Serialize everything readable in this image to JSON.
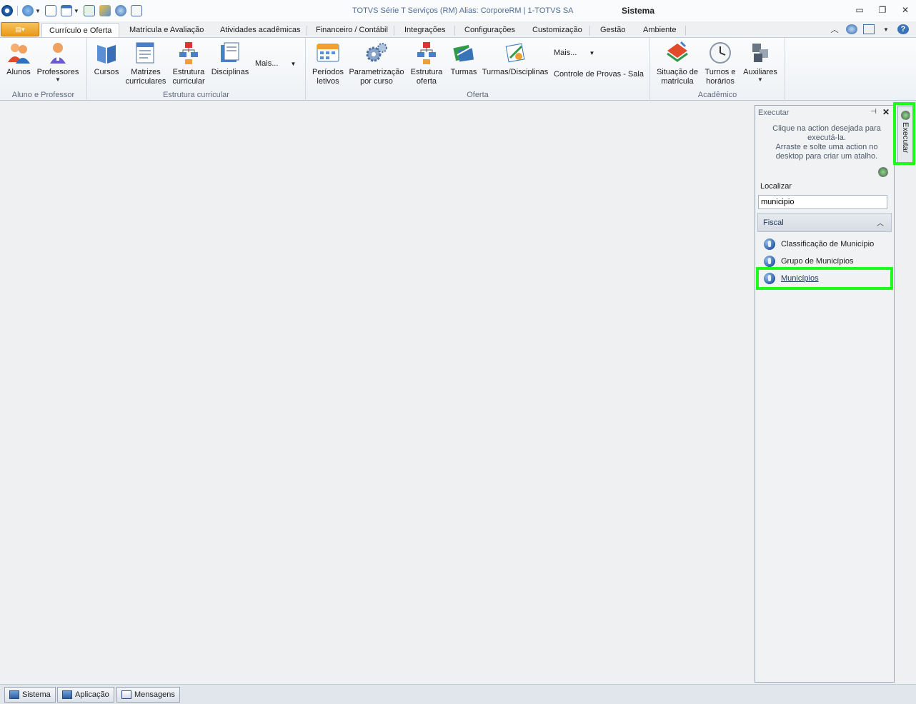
{
  "window": {
    "title": "TOTVS Série T Serviços (RM) Alias: CorporeRM | 1-TOTVS SA",
    "context": "Sistema"
  },
  "tabs": [
    {
      "label": "Currículo e Oferta"
    },
    {
      "label": "Matrícula e Avaliação"
    },
    {
      "label": "Atividades acadêmicas"
    },
    {
      "label": "Financeiro / Contábil"
    },
    {
      "label": "Integrações"
    },
    {
      "label": "Configurações"
    },
    {
      "label": "Customização"
    },
    {
      "label": "Gestão"
    },
    {
      "label": "Ambiente"
    }
  ],
  "ribbon": {
    "groups": {
      "aluno_professor": {
        "label": "Aluno e Professor",
        "buttons": {
          "alunos": "Alunos",
          "professores": "Professores"
        }
      },
      "estrutura": {
        "label": "Estrutura curricular",
        "buttons": {
          "cursos": "Cursos",
          "matrizes_1": "Matrizes",
          "matrizes_2": "curriculares",
          "estrutura_1": "Estrutura",
          "estrutura_2": "curricular",
          "disciplinas": "Disciplinas",
          "mais": "Mais..."
        }
      },
      "oferta": {
        "label": "Oferta",
        "buttons": {
          "periodos_1": "Períodos",
          "periodos_2": "letivos",
          "param_1": "Parametrização",
          "param_2": "por curso",
          "estrutura_oferta_1": "Estrutura",
          "estrutura_oferta_2": "oferta",
          "turmas": "Turmas",
          "turmas_disciplinas": "Turmas/Disciplinas",
          "mais": "Mais...",
          "controle_provas": "Controle de Provas - Sala"
        }
      },
      "academico": {
        "label": "Acadêmico",
        "buttons": {
          "situacao_1": "Situação de",
          "situacao_2": "matrícula",
          "turnos_1": "Turnos e",
          "turnos_2": "horários",
          "auxiliares": "Auxiliares"
        }
      }
    }
  },
  "panel": {
    "title": "Executar",
    "help_line1": "Clique na action desejada para executá-la.",
    "help_line2": "Arraste e solte uma action no desktop para criar um atalho.",
    "search_label": "Localizar",
    "search_value": "municipio",
    "category": "Fiscal",
    "items": [
      {
        "label": "Classificação de Município"
      },
      {
        "label": "Grupo de Municípios"
      },
      {
        "label": "Municípios"
      }
    ],
    "side_tab_label": "Executar"
  },
  "statusbar": {
    "buttons": [
      {
        "label": "Sistema"
      },
      {
        "label": "Aplicação"
      },
      {
        "label": "Mensagens"
      }
    ]
  },
  "colors": {
    "highlight": "#1bff1b",
    "app_menu": "#e99a1a"
  }
}
